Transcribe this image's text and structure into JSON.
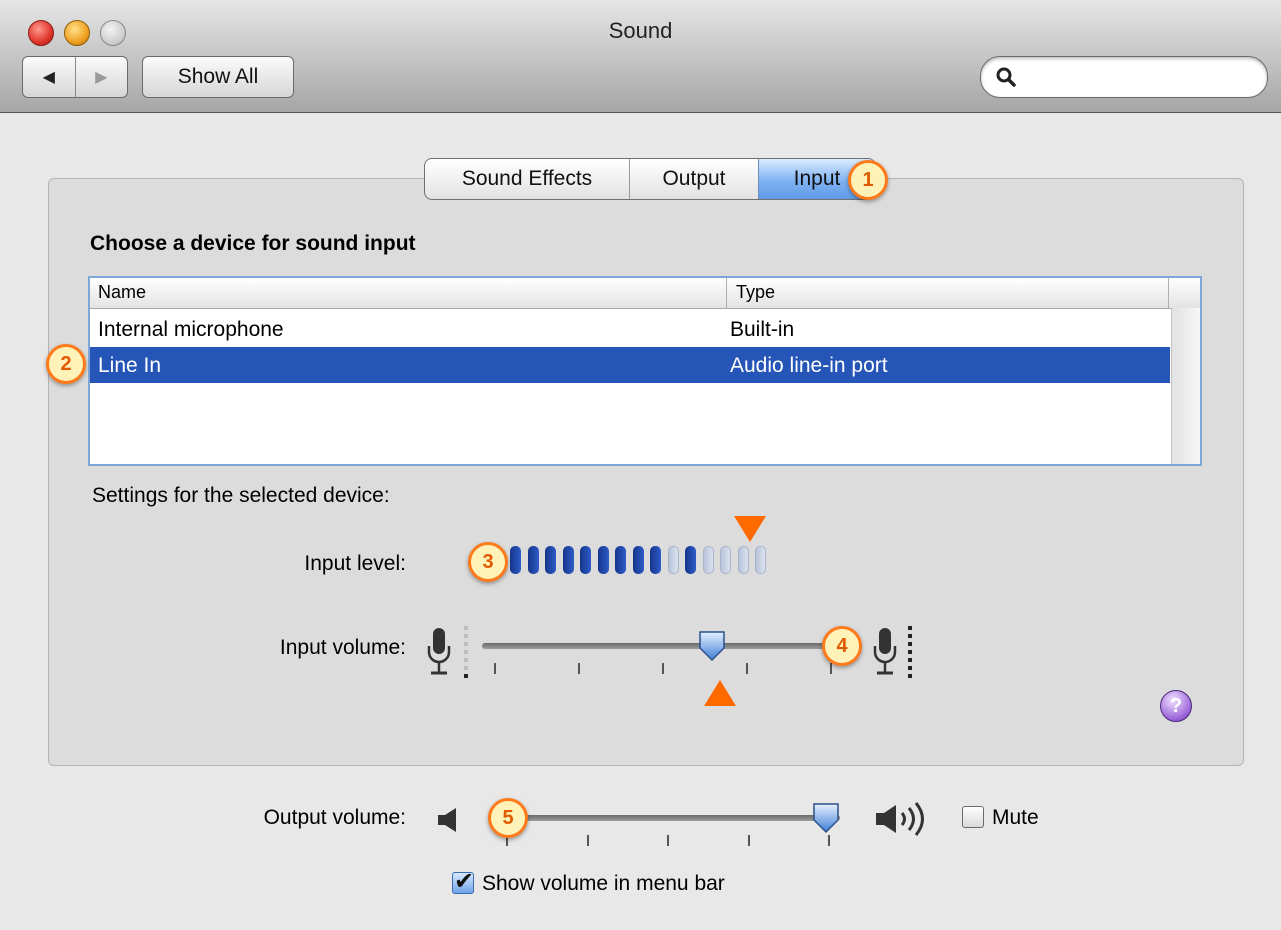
{
  "window": {
    "title": "Sound"
  },
  "toolbar": {
    "back_glyph": "◀",
    "forward_glyph": "▶",
    "show_all_label": "Show All",
    "search_placeholder": ""
  },
  "tabs": [
    {
      "label": "Sound Effects",
      "selected": false
    },
    {
      "label": "Output",
      "selected": false
    },
    {
      "label": "Input",
      "selected": true
    }
  ],
  "device_section": {
    "title": "Choose a device for sound input",
    "columns": [
      "Name",
      "Type"
    ],
    "rows": [
      {
        "name": "Internal microphone",
        "type": "Built-in",
        "selected": false
      },
      {
        "name": "Line In",
        "type": "Audio line-in port",
        "selected": true
      }
    ]
  },
  "settings": {
    "label": "Settings for the selected device:",
    "input_level_label": "Input level:",
    "input_level": {
      "segments_total": 15,
      "segments_lit": 9,
      "peak_segment": 10
    },
    "input_volume_label": "Input volume:",
    "input_volume_fraction": 0.65
  },
  "output": {
    "volume_label": "Output volume:",
    "volume_fraction": 1.0,
    "mute_label": "Mute",
    "mute_checked": false,
    "show_volume_label": "Show volume in menu bar",
    "show_volume_checked": true
  },
  "help": {
    "glyph": "?"
  },
  "callouts": [
    "1",
    "2",
    "3",
    "4",
    "5"
  ],
  "colors": {
    "selection_blue": "#2655b8",
    "tab_selected": "#7fb2f2",
    "callout_orange": "#ff7a1a",
    "meter_on": "#1f46b0"
  }
}
